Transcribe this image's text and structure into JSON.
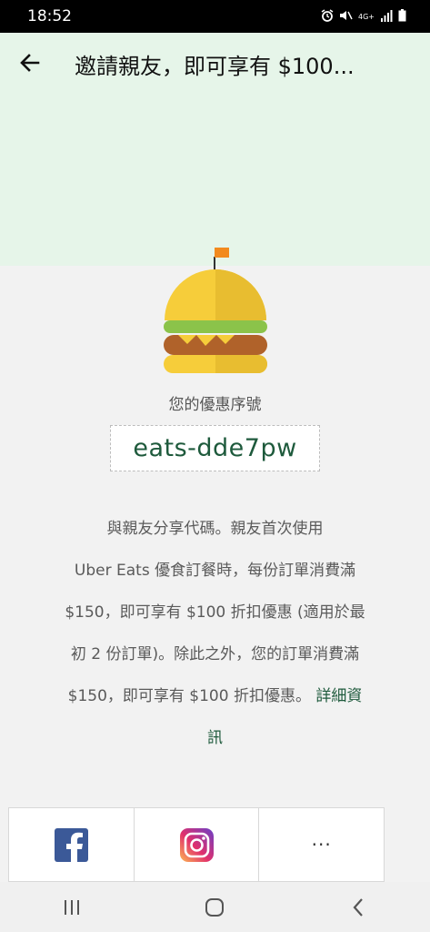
{
  "status": {
    "time": "18:52",
    "network": "4G+"
  },
  "header": {
    "title": "邀請親友，即可享有 $100...",
    "bg_color": "#e6f5e9"
  },
  "promo": {
    "label": "您的優惠序號",
    "code": "eats-dde7pw"
  },
  "description": {
    "lines": [
      "與親友分享代碼。親友首次使用",
      "Uber Eats 優食訂餐時，每份訂單消費滿",
      "$150，即可享有 $100 折扣優惠 (適用於最",
      "初 2 份訂單)。除此之外，您的訂單消費滿",
      "$150，即可享有 $100 折扣優惠。"
    ],
    "link_text_1": "詳細資",
    "link_text_2": "訊"
  },
  "share": {
    "more_label": "···"
  },
  "colors": {
    "accent_green": "#1e5a3c",
    "burger_bun": "#f6cd3a",
    "facebook_blue": "#3b5998"
  }
}
